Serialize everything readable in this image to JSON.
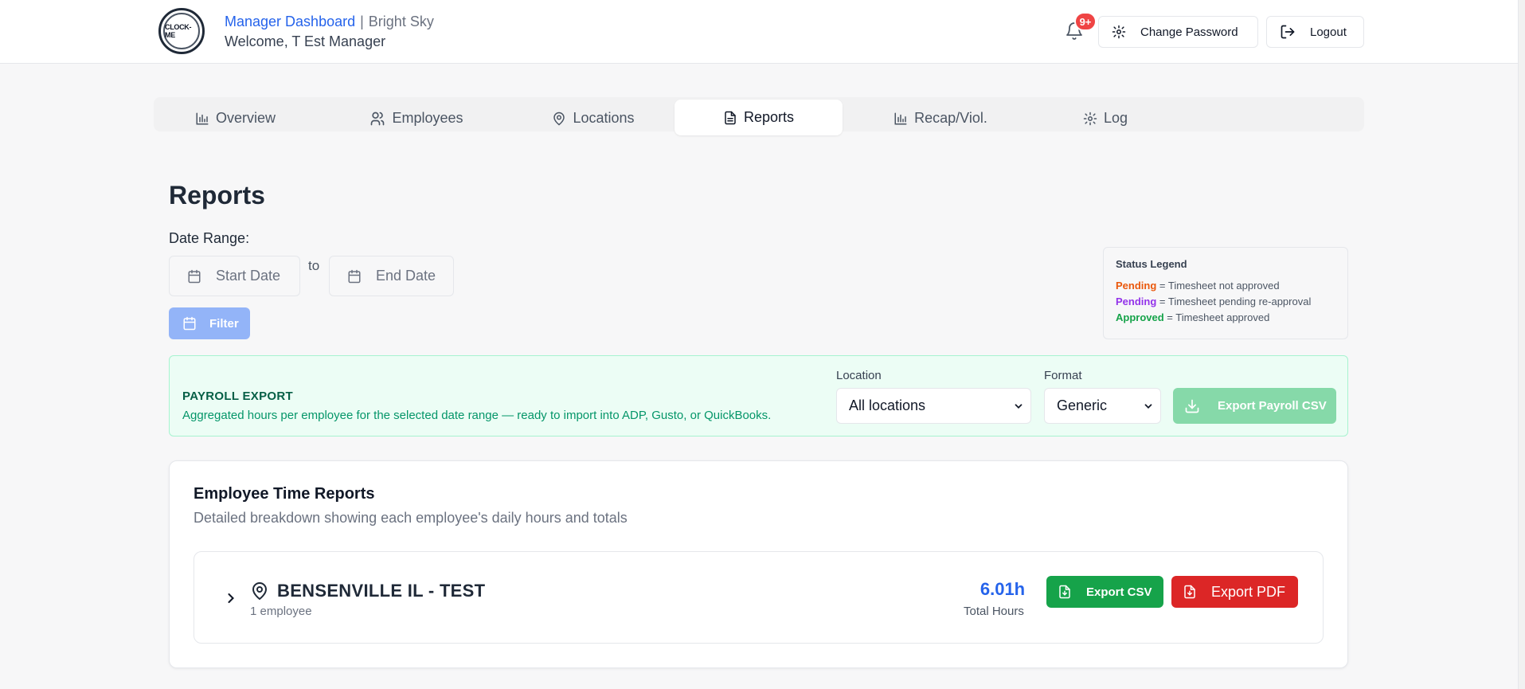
{
  "header": {
    "logo_text": "CLOCK-ME",
    "title": "Manager Dashboard",
    "separator": "|",
    "org": "Bright Sky",
    "welcome": "Welcome, T Est Manager",
    "notification_badge": "9+",
    "change_password_label": "Change Password",
    "logout_label": "Logout"
  },
  "tabs": [
    {
      "label": "Overview",
      "icon": "bar-chart-icon",
      "active": false
    },
    {
      "label": "Employees",
      "icon": "users-icon",
      "active": false
    },
    {
      "label": "Locations",
      "icon": "map-pin-icon",
      "active": false
    },
    {
      "label": "Reports",
      "icon": "file-text-icon",
      "active": true
    },
    {
      "label": "Recap/Viol.",
      "icon": "bar-chart-icon",
      "active": false
    },
    {
      "label": "Log",
      "icon": "gear-icon",
      "active": false
    }
  ],
  "reports": {
    "title": "Reports",
    "date_range_label": "Date Range:",
    "start_placeholder": "Start Date",
    "to_label": "to",
    "end_placeholder": "End Date",
    "filter_label": "Filter"
  },
  "legend": {
    "title": "Status Legend",
    "items": [
      {
        "status": "Pending",
        "text": "= Timesheet not approved",
        "color": "#ea580c"
      },
      {
        "status": "Pending",
        "text": "= Timesheet pending re-approval",
        "color": "#9333ea"
      },
      {
        "status": "Approved",
        "text": "= Timesheet approved",
        "color": "#16a34a"
      }
    ]
  },
  "payroll": {
    "title": "PAYROLL EXPORT",
    "description": "Aggregated hours per employee for the selected date range — ready to import into ADP, Gusto, or QuickBooks.",
    "location_label": "Location",
    "location_value": "All locations",
    "format_label": "Format",
    "format_value": "Generic",
    "export_label": "Export Payroll CSV"
  },
  "time_reports": {
    "title": "Employee Time Reports",
    "subtitle": "Detailed breakdown showing each employee's daily hours and totals",
    "locations": [
      {
        "name": "BENSENVILLE IL - TEST",
        "employee_count": "1 employee",
        "total_hours": "6.01h",
        "total_hours_label": "Total Hours",
        "export_csv_label": "Export CSV",
        "export_pdf_label": "Export PDF"
      }
    ]
  },
  "colors": {
    "accent": "#2563eb",
    "success": "#16a34a",
    "danger": "#dc2626",
    "payroll_bg": "#ecfdf5"
  }
}
